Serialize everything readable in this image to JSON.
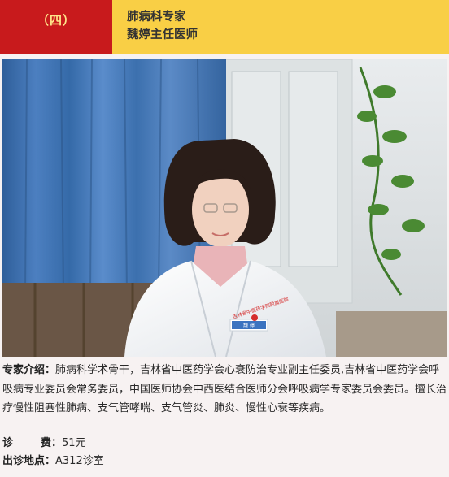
{
  "header": {
    "number": "（四）",
    "department": "肺病科专家",
    "name_title": "魏婷主任医师"
  },
  "photo": {
    "badge_text": "吉林省中医药学院附属医院",
    "card_name": "魏 婷"
  },
  "intro": {
    "label": "专家介绍：",
    "text": "肺病科学术骨干，吉林省中医药学会心衰防治专业副主任委员,吉林省中医药学会呼吸病专业委员会常务委员，中国医师协会中西医结合医师分会呼吸病学专家委员会委员。擅长治疗慢性阻塞性肺病、支气管哮喘、支气管炎、肺炎、慢性心衰等疾病。"
  },
  "fee": {
    "label_a": "诊",
    "label_b": "费：",
    "value": "51元"
  },
  "location": {
    "label": "出诊地点：",
    "value": "A312诊室"
  },
  "colors": {
    "number_bg": "#c81a1c",
    "title_bg": "#f9cf45",
    "number_text": "#ffe58a"
  }
}
